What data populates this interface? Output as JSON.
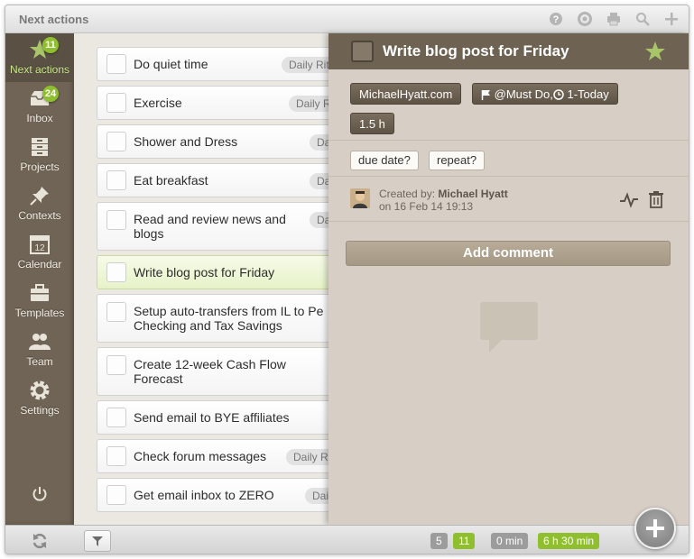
{
  "window": {
    "title": "Next actions"
  },
  "toolbar": {
    "icons": [
      "help-icon",
      "support-icon",
      "print-icon",
      "search-icon",
      "plus-icon"
    ]
  },
  "sidebar": {
    "items": [
      {
        "label": "Next actions",
        "icon": "star-icon",
        "badge": "11",
        "active": true
      },
      {
        "label": "Inbox",
        "icon": "inbox-icon",
        "badge": "24"
      },
      {
        "label": "Projects",
        "icon": "projects-icon"
      },
      {
        "label": "Contexts",
        "icon": "pin-icon"
      },
      {
        "label": "Calendar",
        "icon": "calendar-icon",
        "day": "12"
      },
      {
        "label": "Templates",
        "icon": "toolbox-icon"
      },
      {
        "label": "Team",
        "icon": "team-icon"
      },
      {
        "label": "Settings",
        "icon": "gear-icon"
      }
    ]
  },
  "tasks": [
    {
      "text": "Do quiet time",
      "tag": "Daily Rit"
    },
    {
      "text": "Exercise",
      "tag": "Daily R"
    },
    {
      "text": "Shower and Dress",
      "tag": "Da"
    },
    {
      "text": "Eat breakfast",
      "tag": "Da"
    },
    {
      "text": "Read and review news and blogs",
      "tag": "Da"
    },
    {
      "text": "Write blog post for Friday",
      "tag": "",
      "selected": true
    },
    {
      "text": "Setup auto-transfers from IL to Pe Checking and Tax Savings",
      "tag": ""
    },
    {
      "text": "Create 12-week Cash Flow Forecast",
      "tag": ""
    },
    {
      "text": "Send email to BYE affiliates",
      "tag": ""
    },
    {
      "text": "Check forum messages",
      "tag": "Daily R"
    },
    {
      "text": "Get email inbox to ZERO",
      "tag": "Dai"
    }
  ],
  "detail": {
    "title": "Write blog post for Friday",
    "project": "MichaelHyatt.com",
    "context": "@Must Do,",
    "priority": "1-Today",
    "duration": "1.5 h",
    "due_button": "due date?",
    "repeat_button": "repeat?",
    "created_label": "Created by:",
    "created_by": "Michael Hyatt",
    "created_on": "on 16 Feb 14 19:13",
    "add_comment": "Add comment"
  },
  "bottom": {
    "count_a": "5",
    "count_b": "11",
    "time_a": "0 min",
    "time_b": "6 h 30 min"
  },
  "colors": {
    "accent": "#8fbf2e",
    "sidebar": "#6f6455",
    "header": "#6e6353"
  }
}
